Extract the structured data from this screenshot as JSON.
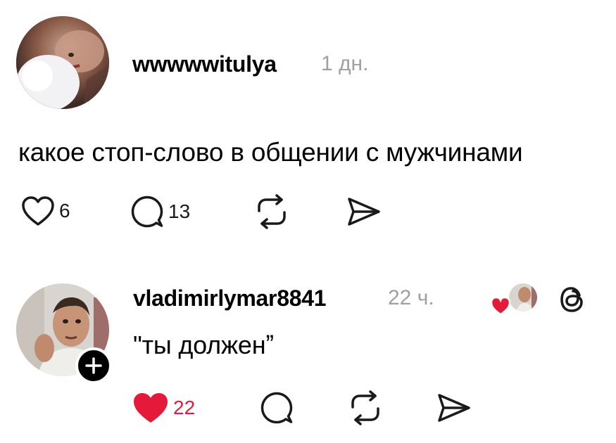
{
  "post": {
    "username": "wwwwwitulya",
    "time": "1 дн.",
    "text": "какое стоп-слово в общении с мужчинами",
    "actions": {
      "like_count": "6",
      "reply_count": "13"
    }
  },
  "reply": {
    "username": "vladimirlymar8841",
    "time": "22 ч.",
    "text": "\"ты долженˮ",
    "liked": true,
    "actions": {
      "like_count": "22"
    }
  },
  "colors": {
    "like_active": "#e51a3a",
    "muted_text": "#a0a0a0",
    "icon": "#1a1a1a"
  },
  "icons": [
    "heart-icon",
    "comment-icon",
    "repost-icon",
    "share-icon",
    "threads-logo-icon",
    "plus-icon"
  ]
}
